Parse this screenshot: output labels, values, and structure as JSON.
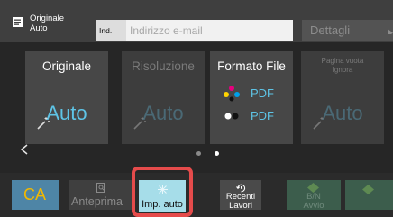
{
  "header": {
    "original_line1": "Originale",
    "original_line2": "Auto",
    "ind_label": "Ind.",
    "email_placeholder": "Indirizzo e-mail",
    "details_label": "Dettagli"
  },
  "cards": [
    {
      "label": "Originale",
      "value": "Auto",
      "enabled": true
    },
    {
      "label": "Risoluzione",
      "value": "Auto",
      "enabled": false
    },
    {
      "label": "Formato File",
      "values": [
        "PDF",
        "PDF"
      ],
      "enabled": true
    },
    {
      "label_line1": "Pagina vuota",
      "label_line2": "Ignora",
      "value": "Auto",
      "enabled": false
    }
  ],
  "pager": {
    "total": 2,
    "active": 1
  },
  "footer": {
    "ca_label": "CA",
    "preview_label": "Anteprima",
    "auto_set_label": "Imp. auto",
    "recent_line1": "Recenti",
    "recent_line2": "Lavori",
    "bw_line1": "B/N",
    "bw_line2": "Avvio"
  },
  "colors": {
    "accent": "#5ec4e6",
    "highlight": "#e54b4b",
    "ca_background": "#4e85a6",
    "ca_text": "#f2b800",
    "start_button": "#3c5d4c",
    "auto_set_background": "#a6dde9"
  },
  "icons": {
    "original": "document-icon",
    "details": "chevron-right-icon",
    "auto_wand": "magic-wand-icon",
    "color_dots": "color-dots-icon",
    "bw_dots": "bw-dots-icon",
    "prev": "chevron-left-icon",
    "preview": "preview-icon",
    "auto_set": "sparkle-icon",
    "recent": "history-icon",
    "start": "diamond-start-icon"
  }
}
